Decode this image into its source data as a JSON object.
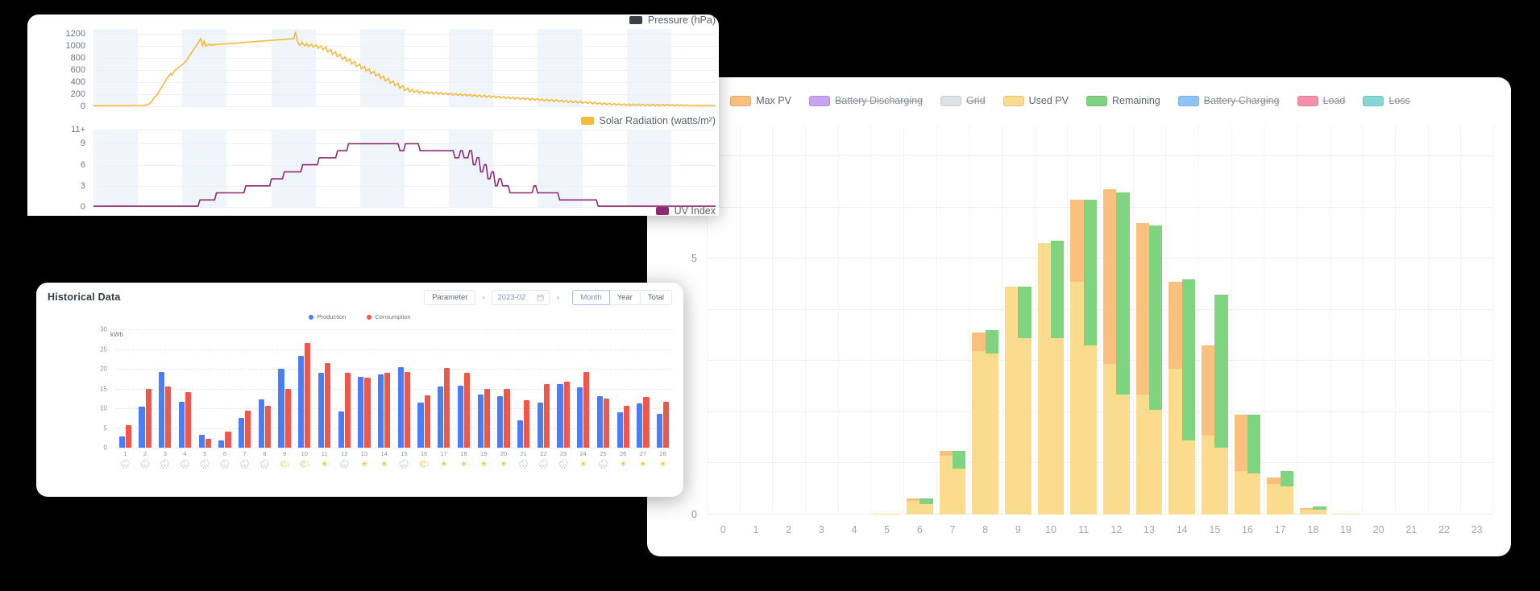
{
  "chart_data": [
    {
      "id": "pressure",
      "type": "line",
      "title": "",
      "ylabel": "Pressure (hPa)",
      "xlabel": "",
      "legend": [
        {
          "label": "Pressure (hPa)",
          "color": "#3b4148",
          "enabled": true
        }
      ],
      "yticks": [
        0,
        200,
        400,
        600,
        800,
        1000,
        1200
      ],
      "ylim": [
        0,
        1280
      ],
      "grid": true,
      "series_color": "#f6b93b",
      "values": [
        10,
        10,
        10,
        10,
        10,
        10,
        10,
        10,
        10,
        10,
        10,
        10,
        10,
        10,
        10,
        10,
        10,
        10,
        10,
        10,
        10,
        10,
        10,
        10,
        12,
        14,
        14,
        13,
        13,
        14,
        15,
        16,
        18,
        22,
        30,
        45,
        70,
        110,
        150,
        170,
        200,
        250,
        300,
        340,
        380,
        420,
        470,
        500,
        540,
        520,
        560,
        600,
        620,
        640,
        660,
        680,
        700,
        730,
        760,
        800,
        840,
        880,
        920,
        960,
        1000,
        1040,
        1080,
        1120,
        1000,
        1080,
        990,
        1020,
        1030,
        1010,
        1020,
        1015,
        1025,
        1030,
        1028,
        1030,
        1032,
        1031,
        1033,
        1035,
        1037,
        1038,
        1040,
        1042,
        1044,
        1046,
        1048,
        1050,
        1052,
        1055,
        1058,
        1060,
        1062,
        1064,
        1066,
        1068,
        1070,
        1072,
        1074,
        1076,
        1078,
        1080,
        1082,
        1084,
        1086,
        1088,
        1090,
        1092,
        1094,
        1096,
        1098,
        1100,
        1102,
        1104,
        1106,
        1108,
        1110,
        1112,
        1114,
        1116,
        1118,
        1120,
        1240,
        1100,
        1030,
        1010,
        1060,
        1020,
        1000,
        1040,
        990,
        1010,
        1030,
        980,
        1000,
        1020,
        960,
        980,
        1000,
        940,
        960,
        980,
        900,
        920,
        940,
        860,
        880,
        900,
        820,
        840,
        860,
        780,
        800,
        820,
        740,
        760,
        780,
        700,
        720,
        740,
        660,
        680,
        700,
        620,
        640,
        660,
        580,
        600,
        620,
        540,
        560,
        580,
        500,
        520,
        540,
        460,
        480,
        500,
        420,
        440,
        460,
        380,
        400,
        420,
        340,
        360,
        380,
        300,
        320,
        340,
        260,
        280,
        300,
        240,
        260,
        280,
        230,
        250,
        260,
        220,
        240,
        250,
        215,
        230,
        240,
        210,
        225,
        235,
        205,
        220,
        230,
        200,
        215,
        225,
        195,
        210,
        220,
        190,
        205,
        215,
        185,
        200,
        210,
        180,
        195,
        205,
        175,
        190,
        200,
        170,
        185,
        195,
        165,
        180,
        190,
        160,
        175,
        185,
        155,
        170,
        180,
        150,
        165,
        175,
        145,
        160,
        170,
        140,
        155,
        165,
        135,
        150,
        160,
        130,
        145,
        155,
        125,
        140,
        150,
        120,
        135,
        145,
        115,
        130,
        140,
        110,
        125,
        135,
        105,
        120,
        130,
        100,
        115,
        125,
        95,
        110,
        120,
        90,
        105,
        115,
        85,
        100,
        110,
        80,
        95,
        105,
        75,
        90,
        100,
        70,
        85,
        95,
        65,
        80,
        90,
        60,
        75,
        85,
        55,
        70,
        80,
        50,
        65,
        75,
        45,
        60,
        70,
        40,
        55,
        65,
        35,
        50,
        60,
        30,
        45,
        55,
        25,
        40,
        50,
        20,
        35,
        45,
        18,
        32,
        42,
        16,
        30,
        40,
        15,
        28,
        38,
        14,
        26,
        36,
        13,
        25,
        35,
        12,
        24,
        34,
        11,
        23,
        33,
        10,
        22,
        32,
        10,
        21,
        31,
        10,
        20,
        30,
        10,
        20,
        30,
        10,
        20,
        28,
        10,
        18,
        26,
        10,
        16,
        24,
        10,
        15,
        22,
        10,
        14,
        20,
        10,
        13,
        18,
        10,
        12,
        16,
        10,
        11,
        14,
        10,
        10,
        12,
        10,
        10,
        10
      ]
    },
    {
      "id": "solar_radiation",
      "type": "line",
      "ylabel": "Solar Radiation (watts/m²)",
      "legend": [
        {
          "label": "Solar Radiation (watts/m²)",
          "color": "#f6b93b",
          "enabled": true
        }
      ],
      "yticks": [
        0,
        3,
        6,
        9,
        "11+"
      ],
      "ylim": [
        0,
        11
      ],
      "grid": true,
      "series_color": "#f6b93b"
    },
    {
      "id": "uv_index",
      "type": "line",
      "ylabel": "UV Index",
      "legend": [
        {
          "label": "UV Index",
          "color": "#8e2a71",
          "enabled": true
        }
      ],
      "yticks": [
        0,
        3,
        6,
        9,
        "11+"
      ],
      "ylim": [
        0,
        11
      ],
      "grid": true,
      "series_color": "#8e2a71",
      "values": [
        0.1,
        0.1,
        0.1,
        0.1,
        0.1,
        0.1,
        0.1,
        0.1,
        0.1,
        0.1,
        0.1,
        0.1,
        0.1,
        0.1,
        0.1,
        0.1,
        0.1,
        0.1,
        0.1,
        0.1,
        0.1,
        0.1,
        0.1,
        0.1,
        0.1,
        0.1,
        0.1,
        0.1,
        0.1,
        0.1,
        0.1,
        0.1,
        0.1,
        0.1,
        0.1,
        0.1,
        0.1,
        0.1,
        0.1,
        0.1,
        0.1,
        0.1,
        0.1,
        0.1,
        0.1,
        0.1,
        0.1,
        0.1,
        0.1,
        0.1,
        0.1,
        0.1,
        0.1,
        0.1,
        0.1,
        0.1,
        0.1,
        0.1,
        1,
        1,
        1,
        1,
        1,
        1,
        1,
        1,
        1,
        2,
        2,
        2,
        2,
        2,
        2,
        2,
        2,
        2,
        2,
        2,
        2,
        2,
        2,
        2,
        2,
        3,
        3,
        3,
        3,
        3,
        3,
        3,
        3,
        3,
        3,
        3,
        3,
        3,
        3,
        4,
        4,
        4,
        4,
        4,
        4,
        4,
        5,
        5,
        5,
        5,
        5,
        5,
        5,
        5,
        5,
        5,
        6,
        6,
        6,
        6,
        6,
        6,
        6,
        6,
        6,
        7,
        7,
        7,
        7,
        7,
        7,
        7,
        7,
        7,
        7,
        8,
        8,
        8,
        8,
        8,
        8,
        9,
        9,
        9,
        9,
        9,
        9,
        9,
        9,
        9,
        9,
        9,
        9,
        9,
        9,
        9,
        9,
        9,
        9,
        9,
        9,
        9,
        9,
        9,
        9,
        9,
        9,
        9,
        9,
        8,
        8,
        8,
        9,
        9,
        9,
        9,
        9,
        9,
        9,
        9,
        8,
        8,
        8,
        8,
        8,
        8,
        8,
        8,
        8,
        8,
        8,
        8,
        8,
        8,
        8,
        8,
        8,
        8,
        8,
        7,
        7,
        7,
        8,
        8,
        7,
        7,
        7,
        8,
        8,
        6,
        6,
        7,
        7,
        5,
        5,
        6,
        6,
        4,
        4,
        5,
        5,
        3,
        3,
        4,
        4,
        3,
        3,
        3,
        3,
        2,
        2,
        2,
        2,
        2,
        2,
        2,
        2,
        2,
        2,
        2,
        2,
        2,
        3,
        3,
        2,
        2,
        2,
        2,
        2,
        2,
        2,
        2,
        2,
        2,
        2,
        2,
        1,
        1,
        1,
        1,
        1,
        1,
        1,
        1,
        1,
        1,
        1,
        1,
        1,
        1,
        1,
        1,
        1,
        1,
        1,
        1,
        1,
        0.1,
        0.1,
        0.1,
        0.1,
        0.1,
        0.1,
        0.1,
        0.1,
        0.1,
        0.1,
        0.1,
        0.1,
        0.1,
        0.1,
        0.1,
        0.1,
        0.1,
        0.1,
        0.1,
        0.1,
        0.1,
        0.1,
        0.1,
        0.1,
        0.1,
        0.1,
        0.1,
        0.1,
        0.1,
        0.1,
        0.1,
        0.1,
        0.1,
        0.1,
        0.1,
        0.1,
        0.1,
        0.1,
        0.1,
        0.1,
        0.1,
        0.1,
        0.1,
        0.1,
        0.1,
        0.1,
        0.1,
        0.1,
        0.1,
        0.1,
        0.1,
        0.1,
        0.1,
        0.1,
        0.1,
        0.1,
        0.1,
        0.1,
        0.1,
        0.1,
        0.1,
        0.1,
        0.1,
        0.1,
        0.1
      ]
    },
    {
      "id": "historical_data",
      "type": "bar",
      "title": "Historical Data",
      "ylabel": "kWh",
      "unit": "kWh",
      "yticks": [
        0,
        5,
        10,
        15,
        20,
        25,
        30
      ],
      "ylim": [
        0,
        30
      ],
      "grid": true,
      "categories": [
        "1",
        "2",
        "3",
        "4",
        "5",
        "6",
        "7",
        "8",
        "9",
        "10",
        "11",
        "12",
        "13",
        "14",
        "15",
        "16",
        "17",
        "18",
        "19",
        "20",
        "21",
        "22",
        "23",
        "24",
        "25",
        "26",
        "27",
        "28"
      ],
      "weather_icons": [
        "rain",
        "rain",
        "rain",
        "rain",
        "rain",
        "rain",
        "rain",
        "rain",
        "partly",
        "partly",
        "sun",
        "rain",
        "sun",
        "sun",
        "rain",
        "partly",
        "sun",
        "sun",
        "sun",
        "sun",
        "rain",
        "rain",
        "rain",
        "sun",
        "rain",
        "sun",
        "sun",
        "sun"
      ],
      "series": [
        {
          "name": "Production",
          "color": "#4a7dfc",
          "values": [
            2.8,
            10.5,
            19.2,
            11.6,
            3.2,
            1.9,
            7.5,
            12.2,
            20.1,
            23.3,
            18.9,
            9.2,
            18.0,
            18.6,
            20.4,
            11.4,
            15.6,
            15.8,
            13.4,
            13.0,
            7.0,
            11.5,
            16.2,
            15.4,
            13.1,
            8.9,
            11.2,
            8.6
          ]
        },
        {
          "name": "Consumption",
          "color": "#f0564a",
          "values": [
            5.7,
            14.9,
            15.5,
            14.0,
            2.2,
            4.1,
            9.4,
            10.7,
            15.0,
            26.5,
            21.5,
            18.9,
            17.7,
            18.9,
            19.2,
            13.2,
            20.3,
            19.0,
            14.8,
            14.9,
            12.0,
            16.2,
            16.8,
            19.2,
            12.5,
            10.6,
            12.9,
            11.6
          ]
        }
      ],
      "legend": [
        {
          "label": "Production",
          "color": "#4a7dfc"
        },
        {
          "label": "Consumption",
          "color": "#f0564a"
        }
      ]
    },
    {
      "id": "daily_pv",
      "type": "bar",
      "xlabel": "",
      "ylabel": "",
      "yticks": [
        0,
        5
      ],
      "ylim": [
        0,
        7.6
      ],
      "grid": true,
      "categories": [
        "0",
        "1",
        "2",
        "3",
        "4",
        "5",
        "6",
        "7",
        "8",
        "9",
        "10",
        "11",
        "12",
        "13",
        "14",
        "15",
        "16",
        "17",
        "18",
        "19",
        "20",
        "21",
        "22",
        "23"
      ],
      "legend": [
        {
          "label": "Max PV",
          "color": "#fbc07d",
          "enabled": true
        },
        {
          "label": "Battery Discharging",
          "color": "#c6a4f2",
          "enabled": false
        },
        {
          "label": "Grid",
          "color": "#dfe2e5",
          "enabled": false
        },
        {
          "label": "Used PV",
          "color": "#fbdb8e",
          "enabled": true
        },
        {
          "label": "Remaining",
          "color": "#7ed47f",
          "enabled": true
        },
        {
          "label": "Battery Charging",
          "color": "#8cc4f5",
          "enabled": false
        },
        {
          "label": "Load",
          "color": "#f78fab",
          "enabled": false
        },
        {
          "label": "Loss",
          "color": "#86d8d4",
          "enabled": false
        }
      ],
      "bars_left": {
        "name": "Max PV / Used PV stack",
        "max_pv": [
          0,
          0,
          0,
          0,
          0,
          0.02,
          0.32,
          1.25,
          3.55,
          4.45,
          5.3,
          6.15,
          6.35,
          5.7,
          4.55,
          3.3,
          1.95,
          0.72,
          0.12,
          0.01,
          0,
          0,
          0,
          0
        ],
        "used_pv": [
          0,
          0,
          0,
          0,
          0,
          0.02,
          0.26,
          1.15,
          3.2,
          4.45,
          5.3,
          4.55,
          2.95,
          2.35,
          2.85,
          1.55,
          0.85,
          0.6,
          0.1,
          0.01,
          0,
          0,
          0,
          0
        ]
      },
      "bars_right": {
        "name": "Used PV + Remaining stack",
        "used_pv": [
          0,
          0,
          0,
          0,
          0,
          0.02,
          0.2,
          0.9,
          3.15,
          3.45,
          3.45,
          3.3,
          2.35,
          2.05,
          1.45,
          1.3,
          0.8,
          0.55,
          0.1,
          0.01,
          0,
          0,
          0,
          0
        ],
        "remaining": [
          0,
          0,
          0,
          0,
          0,
          0.0,
          0.12,
          0.35,
          0.45,
          1.0,
          1.9,
          2.85,
          3.95,
          3.6,
          3.15,
          3.0,
          1.15,
          0.3,
          0.05,
          0.0,
          0,
          0,
          0,
          0
        ]
      }
    }
  ],
  "weather_card": {
    "panels": [
      {
        "legend_label": "Pressure (hPa)",
        "swatch": "#3b4148"
      },
      {
        "legend_label": "Solar Radiation (watts/m²)",
        "swatch": "#f6b93b"
      },
      {
        "legend_label": "UV Index",
        "swatch": "#8e2a71"
      }
    ]
  },
  "hist_card": {
    "title": "Historical Data",
    "toolbar": {
      "parameter_label": "Parameter",
      "prev_label": "‹",
      "next_label": "›",
      "date_value": "2023-02",
      "calendar_icon": "calendar-icon",
      "range_options": [
        "Month",
        "Year",
        "Total"
      ],
      "range_selected": "Month"
    },
    "unit": "kWh"
  }
}
